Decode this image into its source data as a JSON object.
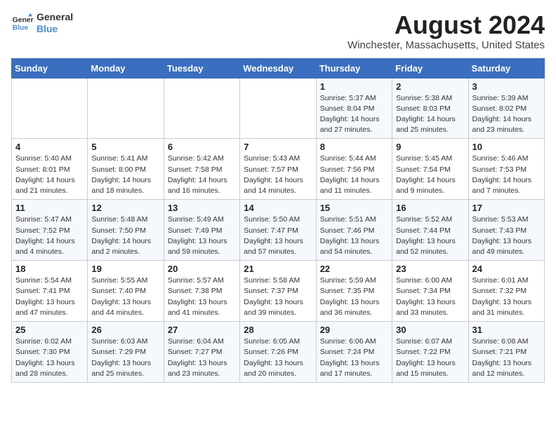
{
  "logo": {
    "line1": "General",
    "line2": "Blue"
  },
  "header": {
    "month_year": "August 2024",
    "location": "Winchester, Massachusetts, United States"
  },
  "weekdays": [
    "Sunday",
    "Monday",
    "Tuesday",
    "Wednesday",
    "Thursday",
    "Friday",
    "Saturday"
  ],
  "weeks": [
    [
      {
        "day": "",
        "info": ""
      },
      {
        "day": "",
        "info": ""
      },
      {
        "day": "",
        "info": ""
      },
      {
        "day": "",
        "info": ""
      },
      {
        "day": "1",
        "info": "Sunrise: 5:37 AM\nSunset: 8:04 PM\nDaylight: 14 hours\nand 27 minutes."
      },
      {
        "day": "2",
        "info": "Sunrise: 5:38 AM\nSunset: 8:03 PM\nDaylight: 14 hours\nand 25 minutes."
      },
      {
        "day": "3",
        "info": "Sunrise: 5:39 AM\nSunset: 8:02 PM\nDaylight: 14 hours\nand 23 minutes."
      }
    ],
    [
      {
        "day": "4",
        "info": "Sunrise: 5:40 AM\nSunset: 8:01 PM\nDaylight: 14 hours\nand 21 minutes."
      },
      {
        "day": "5",
        "info": "Sunrise: 5:41 AM\nSunset: 8:00 PM\nDaylight: 14 hours\nand 18 minutes."
      },
      {
        "day": "6",
        "info": "Sunrise: 5:42 AM\nSunset: 7:58 PM\nDaylight: 14 hours\nand 16 minutes."
      },
      {
        "day": "7",
        "info": "Sunrise: 5:43 AM\nSunset: 7:57 PM\nDaylight: 14 hours\nand 14 minutes."
      },
      {
        "day": "8",
        "info": "Sunrise: 5:44 AM\nSunset: 7:56 PM\nDaylight: 14 hours\nand 11 minutes."
      },
      {
        "day": "9",
        "info": "Sunrise: 5:45 AM\nSunset: 7:54 PM\nDaylight: 14 hours\nand 9 minutes."
      },
      {
        "day": "10",
        "info": "Sunrise: 5:46 AM\nSunset: 7:53 PM\nDaylight: 14 hours\nand 7 minutes."
      }
    ],
    [
      {
        "day": "11",
        "info": "Sunrise: 5:47 AM\nSunset: 7:52 PM\nDaylight: 14 hours\nand 4 minutes."
      },
      {
        "day": "12",
        "info": "Sunrise: 5:48 AM\nSunset: 7:50 PM\nDaylight: 14 hours\nand 2 minutes."
      },
      {
        "day": "13",
        "info": "Sunrise: 5:49 AM\nSunset: 7:49 PM\nDaylight: 13 hours\nand 59 minutes."
      },
      {
        "day": "14",
        "info": "Sunrise: 5:50 AM\nSunset: 7:47 PM\nDaylight: 13 hours\nand 57 minutes."
      },
      {
        "day": "15",
        "info": "Sunrise: 5:51 AM\nSunset: 7:46 PM\nDaylight: 13 hours\nand 54 minutes."
      },
      {
        "day": "16",
        "info": "Sunrise: 5:52 AM\nSunset: 7:44 PM\nDaylight: 13 hours\nand 52 minutes."
      },
      {
        "day": "17",
        "info": "Sunrise: 5:53 AM\nSunset: 7:43 PM\nDaylight: 13 hours\nand 49 minutes."
      }
    ],
    [
      {
        "day": "18",
        "info": "Sunrise: 5:54 AM\nSunset: 7:41 PM\nDaylight: 13 hours\nand 47 minutes."
      },
      {
        "day": "19",
        "info": "Sunrise: 5:55 AM\nSunset: 7:40 PM\nDaylight: 13 hours\nand 44 minutes."
      },
      {
        "day": "20",
        "info": "Sunrise: 5:57 AM\nSunset: 7:38 PM\nDaylight: 13 hours\nand 41 minutes."
      },
      {
        "day": "21",
        "info": "Sunrise: 5:58 AM\nSunset: 7:37 PM\nDaylight: 13 hours\nand 39 minutes."
      },
      {
        "day": "22",
        "info": "Sunrise: 5:59 AM\nSunset: 7:35 PM\nDaylight: 13 hours\nand 36 minutes."
      },
      {
        "day": "23",
        "info": "Sunrise: 6:00 AM\nSunset: 7:34 PM\nDaylight: 13 hours\nand 33 minutes."
      },
      {
        "day": "24",
        "info": "Sunrise: 6:01 AM\nSunset: 7:32 PM\nDaylight: 13 hours\nand 31 minutes."
      }
    ],
    [
      {
        "day": "25",
        "info": "Sunrise: 6:02 AM\nSunset: 7:30 PM\nDaylight: 13 hours\nand 28 minutes."
      },
      {
        "day": "26",
        "info": "Sunrise: 6:03 AM\nSunset: 7:29 PM\nDaylight: 13 hours\nand 25 minutes."
      },
      {
        "day": "27",
        "info": "Sunrise: 6:04 AM\nSunset: 7:27 PM\nDaylight: 13 hours\nand 23 minutes."
      },
      {
        "day": "28",
        "info": "Sunrise: 6:05 AM\nSunset: 7:26 PM\nDaylight: 13 hours\nand 20 minutes."
      },
      {
        "day": "29",
        "info": "Sunrise: 6:06 AM\nSunset: 7:24 PM\nDaylight: 13 hours\nand 17 minutes."
      },
      {
        "day": "30",
        "info": "Sunrise: 6:07 AM\nSunset: 7:22 PM\nDaylight: 13 hours\nand 15 minutes."
      },
      {
        "day": "31",
        "info": "Sunrise: 6:08 AM\nSunset: 7:21 PM\nDaylight: 13 hours\nand 12 minutes."
      }
    ]
  ]
}
